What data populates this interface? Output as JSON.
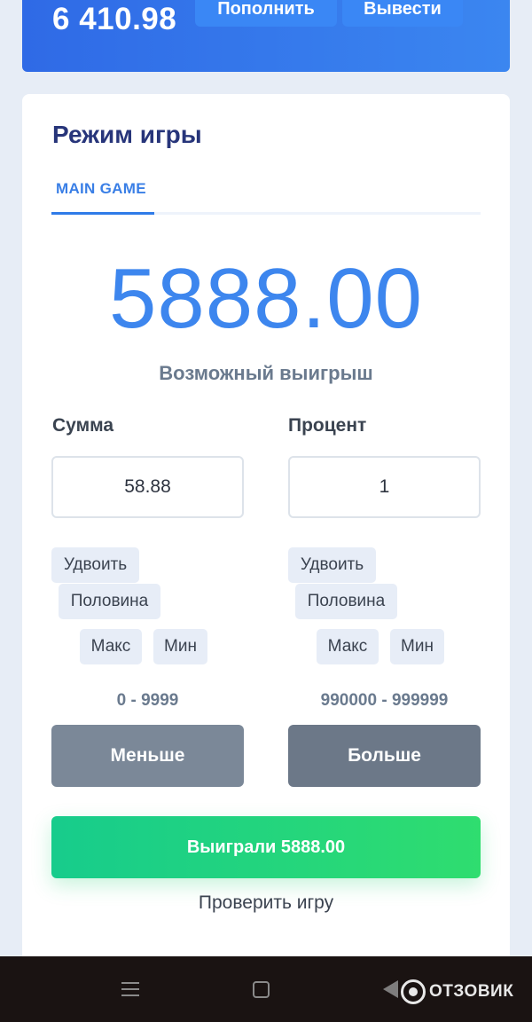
{
  "header": {
    "balance": "6 410.98",
    "deposit_label": "Пополнить",
    "withdraw_label": "Вывести"
  },
  "game": {
    "title": "Режим игры",
    "tab_label": "MAIN GAME",
    "payout_value": "5888.00",
    "payout_label": "Возможный выигрыш"
  },
  "amount": {
    "label": "Сумма",
    "value": "58.88",
    "chips": {
      "double": "Удвоить",
      "half": "Половина",
      "max": "Макс",
      "min": "Мин"
    },
    "range": "0 - 9999",
    "action_label": "Меньше"
  },
  "percent": {
    "label": "Процент",
    "value": "1",
    "chips": {
      "double": "Удвоить",
      "half": "Половина",
      "max": "Макс",
      "min": "Мин"
    },
    "range": "990000 - 999999",
    "action_label": "Больше"
  },
  "result": {
    "label": "Выиграли 5888.00",
    "verify_label": "Проверить игру"
  },
  "watermark": "ОТЗОВИК",
  "colors": {
    "primary_blue": "#3d86ee",
    "title_navy": "#27357a",
    "win_green": "#1fd47c",
    "action_gray": "#7b8898"
  }
}
